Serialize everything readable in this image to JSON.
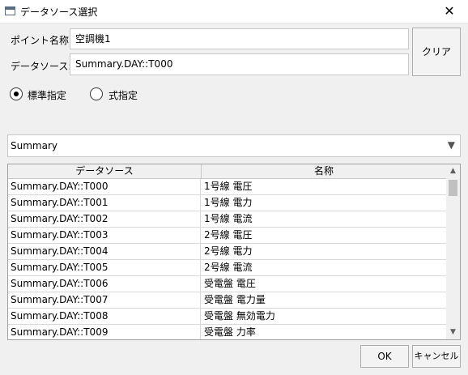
{
  "window": {
    "title": "データソース選択",
    "close_glyph": "✕"
  },
  "form": {
    "point_name_label": "ポイント名称:",
    "point_name_value": "空調機1",
    "data_source_label": "データソース:",
    "data_source_value": "Summary.DAY::T000",
    "clear_button": "クリア"
  },
  "mode": {
    "standard_label": "標準指定",
    "formula_label": "式指定",
    "selected": "standard"
  },
  "combo": {
    "value": "Summary",
    "arrow_glyph": "▼"
  },
  "table": {
    "columns": [
      "データソース",
      "名称"
    ],
    "rows": [
      [
        "Summary.DAY::T000",
        "1号線 電圧"
      ],
      [
        "Summary.DAY::T001",
        "1号線 電力"
      ],
      [
        "Summary.DAY::T002",
        "1号線 電流"
      ],
      [
        "Summary.DAY::T003",
        "2号線 電圧"
      ],
      [
        "Summary.DAY::T004",
        "2号線 電力"
      ],
      [
        "Summary.DAY::T005",
        "2号線 電流"
      ],
      [
        "Summary.DAY::T006",
        "受電盤 電圧"
      ],
      [
        "Summary.DAY::T007",
        "受電盤 電力量"
      ],
      [
        "Summary.DAY::T008",
        "受電盤 無効電力"
      ],
      [
        "Summary.DAY::T009",
        "受電盤 力率"
      ]
    ],
    "scroll_up_glyph": "▲",
    "scroll_down_glyph": "▼"
  },
  "footer": {
    "ok_button": "OK",
    "cancel_button": "キャンセル"
  },
  "icons": {
    "app": "window-icon",
    "close": "close-icon",
    "dropdown": "chevron-down-icon",
    "scroll_up": "arrow-up-icon",
    "scroll_down": "arrow-down-icon"
  }
}
